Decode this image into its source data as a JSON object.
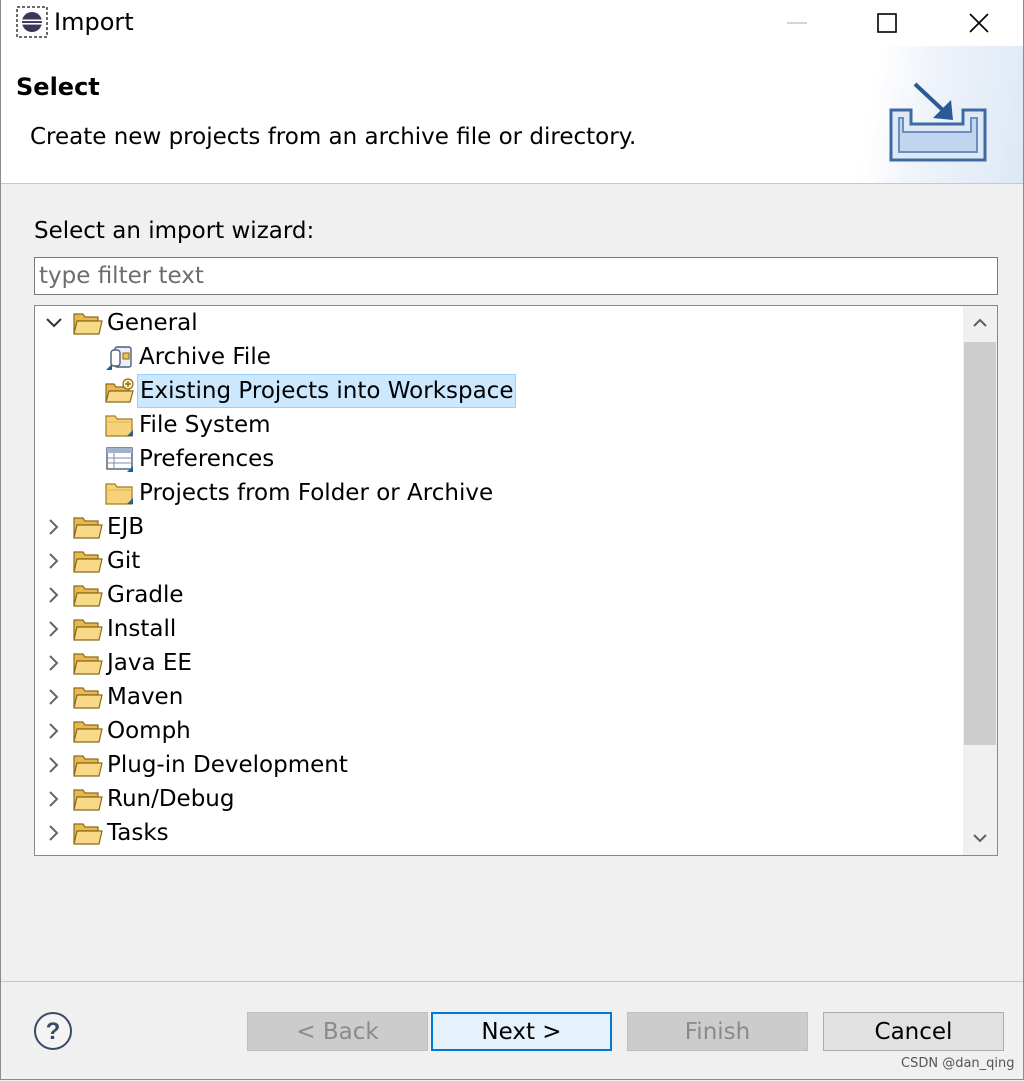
{
  "window": {
    "title": "Import"
  },
  "header": {
    "title": "Select",
    "description": "Create new projects from an archive file or directory."
  },
  "body": {
    "label": "Select an import wizard:",
    "filter_placeholder": "type filter text",
    "filter_value": ""
  },
  "tree": [
    {
      "label": "General",
      "level": 0,
      "expanded": true,
      "icon": "folder-open-icon",
      "selected": false
    },
    {
      "label": "Archive File",
      "level": 1,
      "icon": "archive-file-icon",
      "selected": false
    },
    {
      "label": "Existing Projects into Workspace",
      "level": 1,
      "icon": "import-project-icon",
      "selected": true
    },
    {
      "label": "File System",
      "level": 1,
      "icon": "folder-icon",
      "selected": false
    },
    {
      "label": "Preferences",
      "level": 1,
      "icon": "preferences-icon",
      "selected": false
    },
    {
      "label": "Projects from Folder or Archive",
      "level": 1,
      "icon": "folder-icon",
      "selected": false
    },
    {
      "label": "EJB",
      "level": 0,
      "expanded": false,
      "icon": "folder-open-icon",
      "selected": false
    },
    {
      "label": "Git",
      "level": 0,
      "expanded": false,
      "icon": "folder-open-icon",
      "selected": false
    },
    {
      "label": "Gradle",
      "level": 0,
      "expanded": false,
      "icon": "folder-open-icon",
      "selected": false
    },
    {
      "label": "Install",
      "level": 0,
      "expanded": false,
      "icon": "folder-open-icon",
      "selected": false
    },
    {
      "label": "Java EE",
      "level": 0,
      "expanded": false,
      "icon": "folder-open-icon",
      "selected": false
    },
    {
      "label": "Maven",
      "level": 0,
      "expanded": false,
      "icon": "folder-open-icon",
      "selected": false
    },
    {
      "label": "Oomph",
      "level": 0,
      "expanded": false,
      "icon": "folder-open-icon",
      "selected": false
    },
    {
      "label": "Plug-in Development",
      "level": 0,
      "expanded": false,
      "icon": "folder-open-icon",
      "selected": false
    },
    {
      "label": "Run/Debug",
      "level": 0,
      "expanded": false,
      "icon": "folder-open-icon",
      "selected": false
    },
    {
      "label": "Tasks",
      "level": 0,
      "expanded": false,
      "icon": "folder-open-icon",
      "selected": false
    }
  ],
  "buttons": {
    "back": "< Back",
    "next": "Next >",
    "finish": "Finish",
    "cancel": "Cancel"
  },
  "watermark": "CSDN @dan_qing",
  "colors": {
    "selection_bg": "#cce8ff",
    "selection_border": "#99d1ff",
    "default_button_border": "#0078d7",
    "folder_yellow": "#f3c964",
    "icon_blue": "#1f5f9e"
  }
}
